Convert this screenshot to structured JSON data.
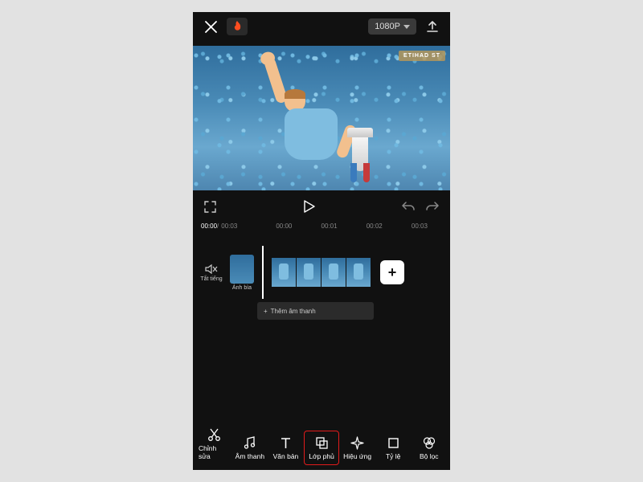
{
  "topbar": {
    "resolution": "1080P"
  },
  "preview": {
    "cornerBadge": "ETIHAD ST"
  },
  "transport": {
    "currentTime": "00:00",
    "duration": "00:03",
    "ticks": [
      "00:00",
      "00:01",
      "00:02",
      "00:03"
    ]
  },
  "timeline": {
    "muteLabel": "Tắt tiếng",
    "coverLabel": "Ảnh bìa",
    "addAudio": "Thêm âm thanh"
  },
  "bottombar": {
    "items": [
      {
        "label": "Chỉnh sửa",
        "icon": "scissors",
        "highlight": false
      },
      {
        "label": "Âm thanh",
        "icon": "music",
        "highlight": false
      },
      {
        "label": "Văn bản",
        "icon": "text",
        "highlight": false
      },
      {
        "label": "Lớp phủ",
        "icon": "overlay",
        "highlight": true
      },
      {
        "label": "Hiệu ứng",
        "icon": "sparkle",
        "highlight": false
      },
      {
        "label": "Tỷ lệ",
        "icon": "ratio",
        "highlight": false
      },
      {
        "label": "Bộ lọc",
        "icon": "filter",
        "highlight": false
      }
    ]
  }
}
